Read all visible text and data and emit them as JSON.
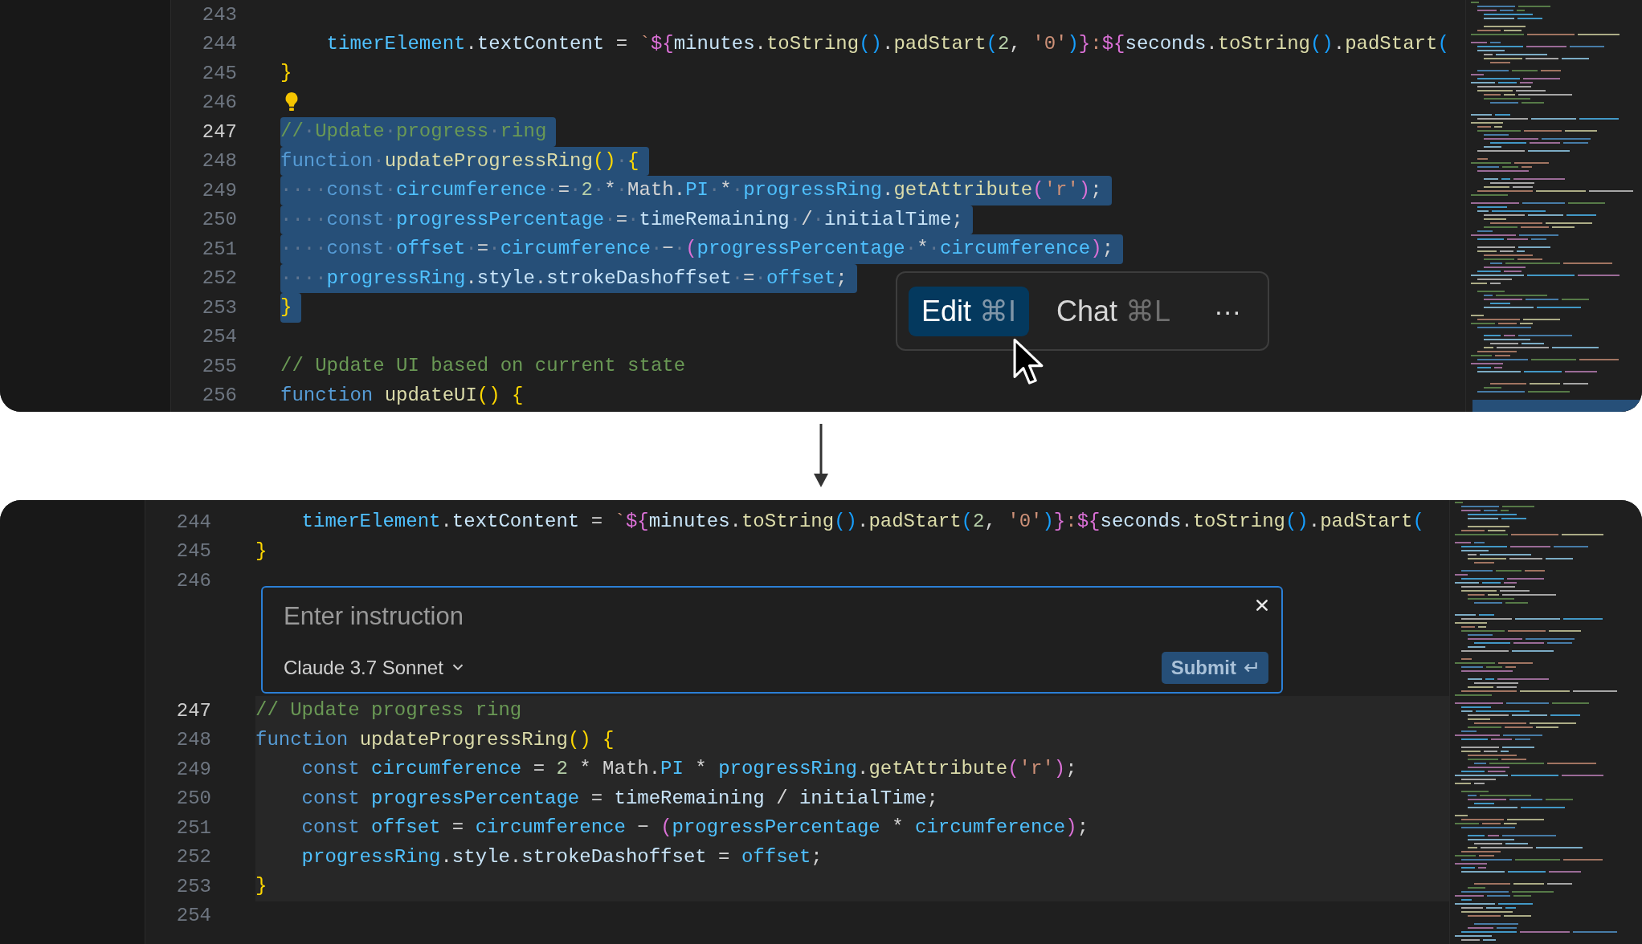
{
  "before": {
    "lines": [
      {
        "number": "243",
        "current": false,
        "selected": false,
        "lightbulb": false
      },
      {
        "number": "244",
        "current": false,
        "selected": false,
        "lightbulb": false,
        "indented": true,
        "tokens": [
          {
            "kind": "cv",
            "text": "timerElement"
          },
          {
            "kind": "p",
            "text": "."
          },
          {
            "kind": "v",
            "text": "textContent"
          },
          {
            "kind": "p",
            "text": " = "
          },
          {
            "kind": "s",
            "text": "`"
          },
          {
            "kind": "b2",
            "text": "${"
          },
          {
            "kind": "v",
            "text": "minutes"
          },
          {
            "kind": "p",
            "text": "."
          },
          {
            "kind": "fn",
            "text": "toString"
          },
          {
            "kind": "b3",
            "text": "()"
          },
          {
            "kind": "p",
            "text": "."
          },
          {
            "kind": "fn",
            "text": "padStart"
          },
          {
            "kind": "b3",
            "text": "("
          },
          {
            "kind": "n",
            "text": "2"
          },
          {
            "kind": "p",
            "text": ", "
          },
          {
            "kind": "s",
            "text": "'0'"
          },
          {
            "kind": "b3",
            "text": ")"
          },
          {
            "kind": "b2",
            "text": "}"
          },
          {
            "kind": "s",
            "text": ":"
          },
          {
            "kind": "b2",
            "text": "${"
          },
          {
            "kind": "v",
            "text": "seconds"
          },
          {
            "kind": "p",
            "text": "."
          },
          {
            "kind": "fn",
            "text": "toString"
          },
          {
            "kind": "b3",
            "text": "()"
          },
          {
            "kind": "p",
            "text": "."
          },
          {
            "kind": "fn",
            "text": "padStart"
          },
          {
            "kind": "b3",
            "text": "("
          }
        ]
      },
      {
        "number": "245",
        "current": false,
        "selected": false,
        "lightbulb": false,
        "tokens": [
          {
            "kind": "b1",
            "text": "}"
          }
        ]
      },
      {
        "number": "246",
        "current": false,
        "selected": false,
        "lightbulb": true
      },
      {
        "number": "247",
        "current": true,
        "selected": true,
        "lightbulb": false,
        "tokens": [
          {
            "kind": "c",
            "text": "//"
          },
          {
            "kind": "ws",
            "text": "·"
          },
          {
            "kind": "c",
            "text": "Update"
          },
          {
            "kind": "ws",
            "text": "·"
          },
          {
            "kind": "c",
            "text": "progress"
          },
          {
            "kind": "ws",
            "text": "·"
          },
          {
            "kind": "c",
            "text": "ring"
          }
        ]
      },
      {
        "number": "248",
        "current": false,
        "selected": true,
        "lightbulb": false,
        "tokens": [
          {
            "kind": "kw",
            "text": "function"
          },
          {
            "kind": "ws",
            "text": "·"
          },
          {
            "kind": "fn",
            "text": "updateProgressRing"
          },
          {
            "kind": "b1",
            "text": "()"
          },
          {
            "kind": "ws",
            "text": "·"
          },
          {
            "kind": "b1",
            "text": "{"
          }
        ]
      },
      {
        "number": "249",
        "current": false,
        "selected": true,
        "lightbulb": false,
        "tokens": [
          {
            "kind": "ws",
            "text": "····"
          },
          {
            "kind": "kw",
            "text": "const"
          },
          {
            "kind": "ws",
            "text": "·"
          },
          {
            "kind": "cv",
            "text": "circumference"
          },
          {
            "kind": "ws",
            "text": "·"
          },
          {
            "kind": "p",
            "text": "="
          },
          {
            "kind": "ws",
            "text": "·"
          },
          {
            "kind": "n",
            "text": "2"
          },
          {
            "kind": "ws",
            "text": "·"
          },
          {
            "kind": "p",
            "text": "*"
          },
          {
            "kind": "ws",
            "text": "·"
          },
          {
            "kind": "p",
            "text": "Math"
          },
          {
            "kind": "p",
            "text": "."
          },
          {
            "kind": "cv",
            "text": "PI"
          },
          {
            "kind": "ws",
            "text": "·"
          },
          {
            "kind": "p",
            "text": "*"
          },
          {
            "kind": "ws",
            "text": "·"
          },
          {
            "kind": "cv",
            "text": "progressRing"
          },
          {
            "kind": "p",
            "text": "."
          },
          {
            "kind": "fn",
            "text": "getAttribute"
          },
          {
            "kind": "b2",
            "text": "("
          },
          {
            "kind": "s",
            "text": "'r'"
          },
          {
            "kind": "b2",
            "text": ")"
          },
          {
            "kind": "p",
            "text": ";"
          }
        ]
      },
      {
        "number": "250",
        "current": false,
        "selected": true,
        "lightbulb": false,
        "tokens": [
          {
            "kind": "ws",
            "text": "····"
          },
          {
            "kind": "kw",
            "text": "const"
          },
          {
            "kind": "ws",
            "text": "·"
          },
          {
            "kind": "cv",
            "text": "progressPercentage"
          },
          {
            "kind": "ws",
            "text": "·"
          },
          {
            "kind": "p",
            "text": "="
          },
          {
            "kind": "ws",
            "text": "·"
          },
          {
            "kind": "v",
            "text": "timeRemaining"
          },
          {
            "kind": "ws",
            "text": "·"
          },
          {
            "kind": "p",
            "text": "/"
          },
          {
            "kind": "ws",
            "text": "·"
          },
          {
            "kind": "v",
            "text": "initialTime"
          },
          {
            "kind": "p",
            "text": ";"
          }
        ]
      },
      {
        "number": "251",
        "current": false,
        "selected": true,
        "lightbulb": false,
        "tokens": [
          {
            "kind": "ws",
            "text": "····"
          },
          {
            "kind": "kw",
            "text": "const"
          },
          {
            "kind": "ws",
            "text": "·"
          },
          {
            "kind": "cv",
            "text": "offset"
          },
          {
            "kind": "ws",
            "text": "·"
          },
          {
            "kind": "p",
            "text": "="
          },
          {
            "kind": "ws",
            "text": "·"
          },
          {
            "kind": "cv",
            "text": "circumference"
          },
          {
            "kind": "ws",
            "text": "·"
          },
          {
            "kind": "p",
            "text": "−"
          },
          {
            "kind": "ws",
            "text": "·"
          },
          {
            "kind": "b2",
            "text": "("
          },
          {
            "kind": "cv",
            "text": "progressPercentage"
          },
          {
            "kind": "ws",
            "text": "·"
          },
          {
            "kind": "p",
            "text": "*"
          },
          {
            "kind": "ws",
            "text": "·"
          },
          {
            "kind": "cv",
            "text": "circumference"
          },
          {
            "kind": "b2",
            "text": ")"
          },
          {
            "kind": "p",
            "text": ";"
          }
        ]
      },
      {
        "number": "252",
        "current": false,
        "selected": true,
        "lightbulb": false,
        "tokens": [
          {
            "kind": "ws",
            "text": "····"
          },
          {
            "kind": "cv",
            "text": "progressRing"
          },
          {
            "kind": "p",
            "text": "."
          },
          {
            "kind": "v",
            "text": "style"
          },
          {
            "kind": "p",
            "text": "."
          },
          {
            "kind": "v",
            "text": "strokeDashoffset"
          },
          {
            "kind": "ws",
            "text": "·"
          },
          {
            "kind": "p",
            "text": "="
          },
          {
            "kind": "ws",
            "text": "·"
          },
          {
            "kind": "cv",
            "text": "offset"
          },
          {
            "kind": "p",
            "text": ";"
          }
        ]
      },
      {
        "number": "253",
        "current": false,
        "selected": true,
        "lightbulb": false,
        "tokens": [
          {
            "kind": "b1",
            "text": "}"
          }
        ]
      },
      {
        "number": "254",
        "current": false,
        "selected": false,
        "lightbulb": false
      },
      {
        "number": "255",
        "current": false,
        "selected": false,
        "lightbulb": false,
        "tokens": [
          {
            "kind": "c",
            "text": "// Update UI based on current state"
          }
        ]
      },
      {
        "number": "256",
        "current": false,
        "selected": false,
        "lightbulb": false,
        "tokens": [
          {
            "kind": "kw",
            "text": "function "
          },
          {
            "kind": "fn",
            "text": "updateUI"
          },
          {
            "kind": "b1",
            "text": "()"
          },
          {
            "kind": "b1",
            "text": " {"
          }
        ]
      }
    ],
    "popup": {
      "actions": [
        {
          "label": "Edit",
          "shortcut": "⌘I",
          "selected": true
        },
        {
          "label": "Chat",
          "shortcut": "⌘L",
          "selected": false
        }
      ],
      "more": "···"
    }
  },
  "after": {
    "lines_above": [
      {
        "number": "244",
        "indented": true,
        "tokens": [
          {
            "kind": "cv",
            "text": "timerElement"
          },
          {
            "kind": "p",
            "text": "."
          },
          {
            "kind": "v",
            "text": "textContent"
          },
          {
            "kind": "p",
            "text": " = "
          },
          {
            "kind": "s",
            "text": "`"
          },
          {
            "kind": "b2",
            "text": "${"
          },
          {
            "kind": "v",
            "text": "minutes"
          },
          {
            "kind": "p",
            "text": "."
          },
          {
            "kind": "fn",
            "text": "toString"
          },
          {
            "kind": "b3",
            "text": "()"
          },
          {
            "kind": "p",
            "text": "."
          },
          {
            "kind": "fn",
            "text": "padStart"
          },
          {
            "kind": "b3",
            "text": "("
          },
          {
            "kind": "n",
            "text": "2"
          },
          {
            "kind": "p",
            "text": ", "
          },
          {
            "kind": "s",
            "text": "'0'"
          },
          {
            "kind": "b3",
            "text": ")"
          },
          {
            "kind": "b2",
            "text": "}"
          },
          {
            "kind": "s",
            "text": ":"
          },
          {
            "kind": "b2",
            "text": "${"
          },
          {
            "kind": "v",
            "text": "seconds"
          },
          {
            "kind": "p",
            "text": "."
          },
          {
            "kind": "fn",
            "text": "toString"
          },
          {
            "kind": "b3",
            "text": "()"
          },
          {
            "kind": "p",
            "text": "."
          },
          {
            "kind": "fn",
            "text": "padStart"
          },
          {
            "kind": "b3",
            "text": "("
          }
        ]
      },
      {
        "number": "245",
        "tokens": [
          {
            "kind": "b1",
            "text": "}"
          }
        ]
      },
      {
        "number": "246"
      }
    ],
    "instruction": {
      "placeholder": "Enter instruction",
      "model": "Claude 3.7 Sonnet",
      "submit": "Submit"
    },
    "lines_below": [
      {
        "number": "247",
        "current": true,
        "highlighted": true,
        "tokens": [
          {
            "kind": "c",
            "text": "// Update progress ring"
          }
        ]
      },
      {
        "number": "248",
        "current": false,
        "highlighted": true,
        "tokens": [
          {
            "kind": "kw",
            "text": "function "
          },
          {
            "kind": "fn",
            "text": "updateProgressRing"
          },
          {
            "kind": "b1",
            "text": "()"
          },
          {
            "kind": "b1",
            "text": " {"
          }
        ]
      },
      {
        "number": "249",
        "current": false,
        "highlighted": true,
        "indented": true,
        "tokens": [
          {
            "kind": "kw",
            "text": "const "
          },
          {
            "kind": "cv",
            "text": "circumference"
          },
          {
            "kind": "p",
            "text": " = "
          },
          {
            "kind": "n",
            "text": "2"
          },
          {
            "kind": "p",
            "text": " * Math."
          },
          {
            "kind": "cv",
            "text": "PI"
          },
          {
            "kind": "p",
            "text": " * "
          },
          {
            "kind": "cv",
            "text": "progressRing"
          },
          {
            "kind": "p",
            "text": "."
          },
          {
            "kind": "fn",
            "text": "getAttribute"
          },
          {
            "kind": "b2",
            "text": "("
          },
          {
            "kind": "s",
            "text": "'r'"
          },
          {
            "kind": "b2",
            "text": ")"
          },
          {
            "kind": "p",
            "text": ";"
          }
        ]
      },
      {
        "number": "250",
        "current": false,
        "highlighted": true,
        "indented": true,
        "tokens": [
          {
            "kind": "kw",
            "text": "const "
          },
          {
            "kind": "cv",
            "text": "progressPercentage"
          },
          {
            "kind": "p",
            "text": " = "
          },
          {
            "kind": "v",
            "text": "timeRemaining"
          },
          {
            "kind": "p",
            "text": " / "
          },
          {
            "kind": "v",
            "text": "initialTime"
          },
          {
            "kind": "p",
            "text": ";"
          }
        ]
      },
      {
        "number": "251",
        "current": false,
        "highlighted": true,
        "indented": true,
        "tokens": [
          {
            "kind": "kw",
            "text": "const "
          },
          {
            "kind": "cv",
            "text": "offset"
          },
          {
            "kind": "p",
            "text": " = "
          },
          {
            "kind": "cv",
            "text": "circumference"
          },
          {
            "kind": "p",
            "text": " − "
          },
          {
            "kind": "b2",
            "text": "("
          },
          {
            "kind": "cv",
            "text": "progressPercentage"
          },
          {
            "kind": "p",
            "text": " * "
          },
          {
            "kind": "cv",
            "text": "circumference"
          },
          {
            "kind": "b2",
            "text": ")"
          },
          {
            "kind": "p",
            "text": ";"
          }
        ]
      },
      {
        "number": "252",
        "current": false,
        "highlighted": true,
        "indented": true,
        "tokens": [
          {
            "kind": "cv",
            "text": "progressRing"
          },
          {
            "kind": "p",
            "text": "."
          },
          {
            "kind": "v",
            "text": "style"
          },
          {
            "kind": "p",
            "text": "."
          },
          {
            "kind": "v",
            "text": "strokeDashoffset"
          },
          {
            "kind": "p",
            "text": " = "
          },
          {
            "kind": "cv",
            "text": "offset"
          },
          {
            "kind": "p",
            "text": ";"
          }
        ]
      },
      {
        "number": "253",
        "current": false,
        "highlighted": true,
        "tokens": [
          {
            "kind": "b1",
            "text": "}"
          }
        ]
      },
      {
        "number": "254",
        "current": false,
        "highlighted": false
      }
    ]
  }
}
